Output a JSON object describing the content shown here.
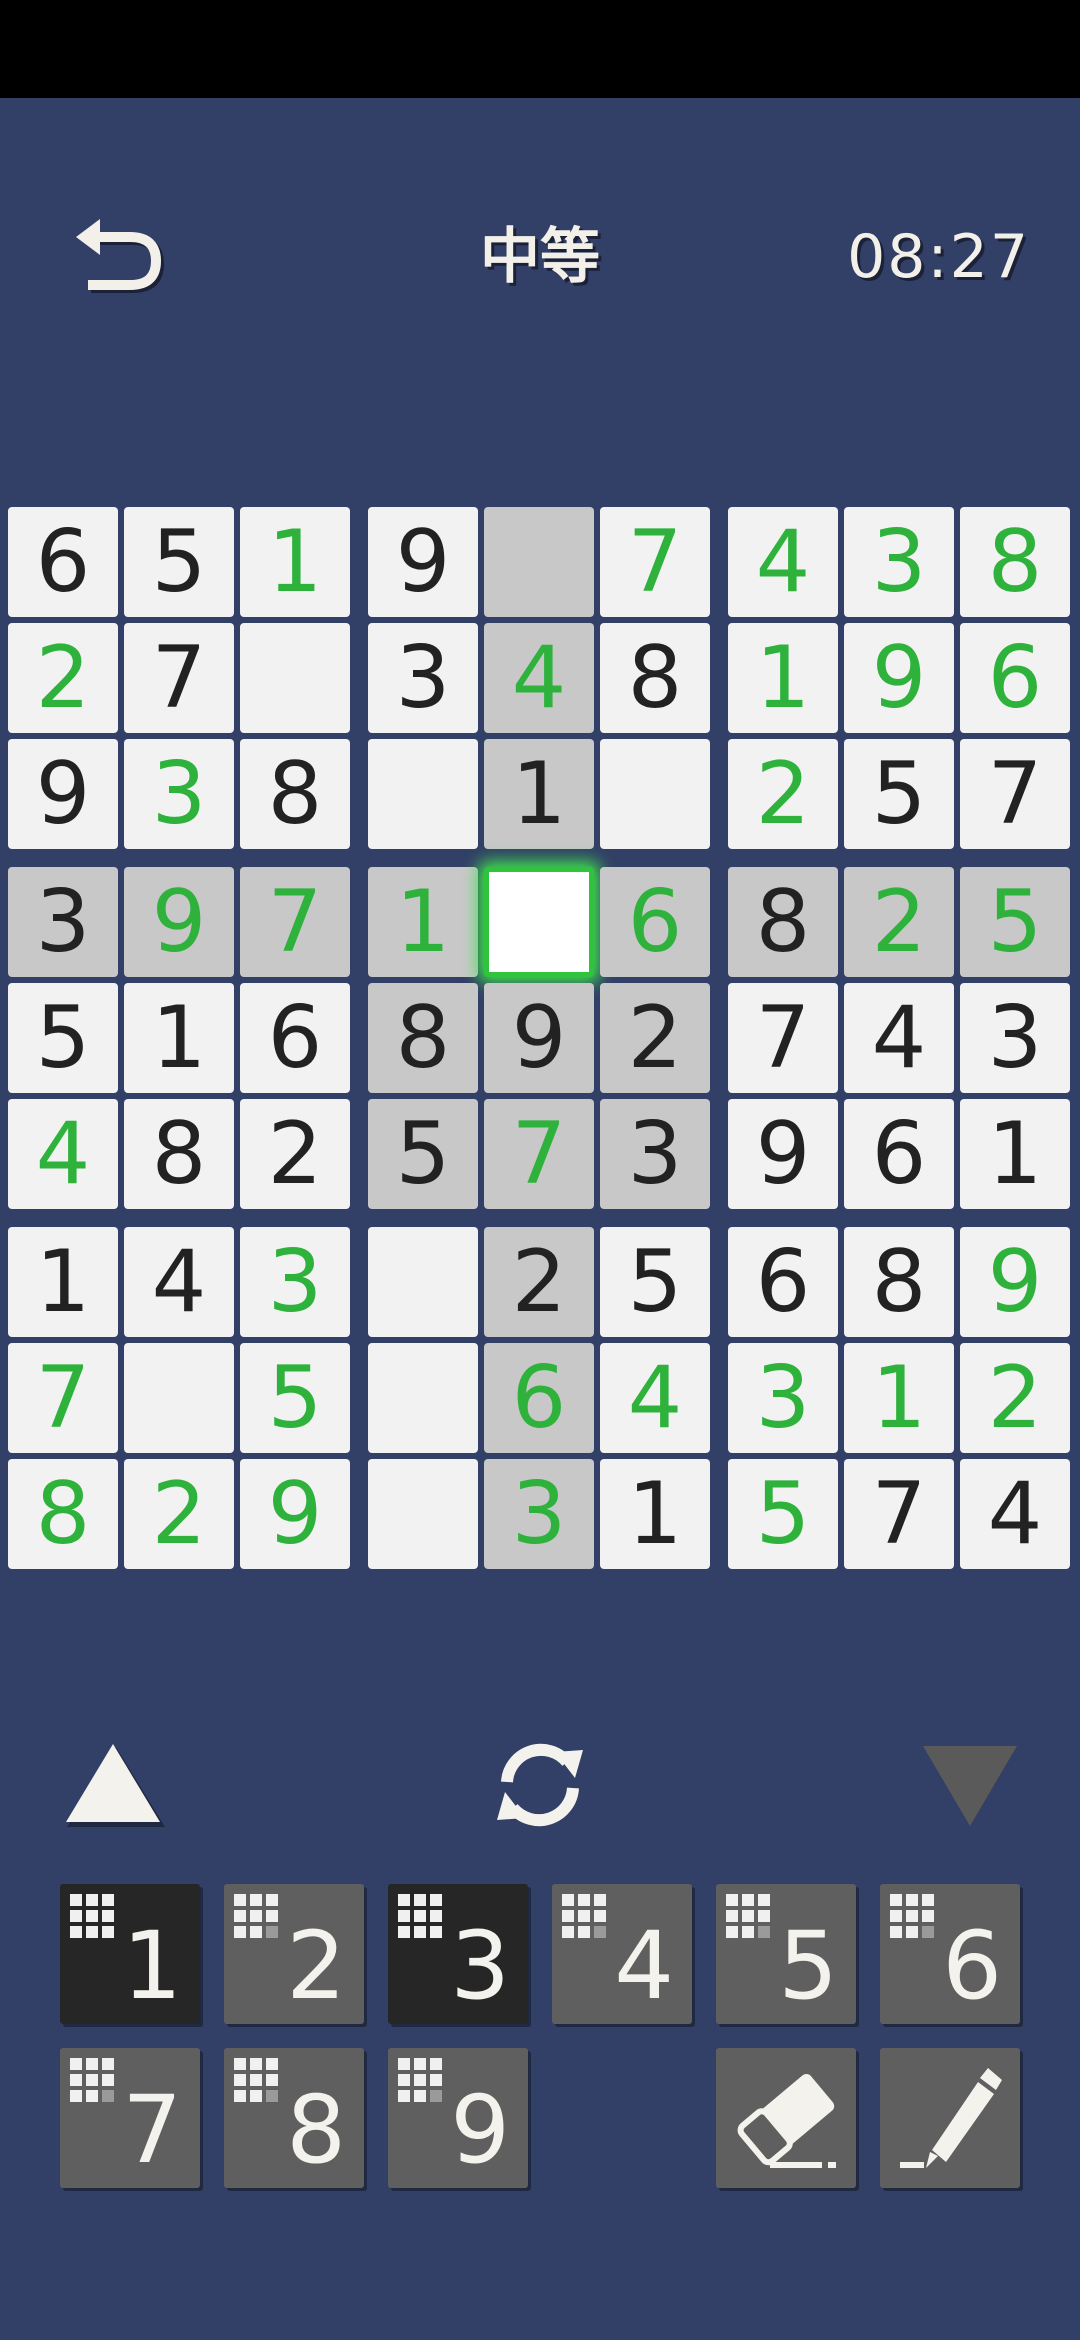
{
  "header": {
    "title": "中等",
    "timer": "08:27"
  },
  "colors": {
    "background": "#323f66",
    "given_digit": "#222222",
    "user_digit": "#2eb23c",
    "highlight": "#c8c8c8",
    "selected_glow": "#3ee04d"
  },
  "board": {
    "selected": [
      3,
      4
    ],
    "cells": [
      [
        {
          "v": "6",
          "t": "g"
        },
        {
          "v": "5",
          "t": "g"
        },
        {
          "v": "1",
          "t": "u"
        },
        {
          "v": "9",
          "t": "g"
        },
        {
          "v": "",
          "t": "e"
        },
        {
          "v": "7",
          "t": "u"
        },
        {
          "v": "4",
          "t": "u"
        },
        {
          "v": "3",
          "t": "u"
        },
        {
          "v": "8",
          "t": "u"
        }
      ],
      [
        {
          "v": "2",
          "t": "u"
        },
        {
          "v": "7",
          "t": "g"
        },
        {
          "v": "",
          "t": "e"
        },
        {
          "v": "3",
          "t": "g"
        },
        {
          "v": "4",
          "t": "u"
        },
        {
          "v": "8",
          "t": "g"
        },
        {
          "v": "1",
          "t": "u"
        },
        {
          "v": "9",
          "t": "u"
        },
        {
          "v": "6",
          "t": "u"
        }
      ],
      [
        {
          "v": "9",
          "t": "g"
        },
        {
          "v": "3",
          "t": "u"
        },
        {
          "v": "8",
          "t": "g"
        },
        {
          "v": "",
          "t": "e"
        },
        {
          "v": "1",
          "t": "g"
        },
        {
          "v": "",
          "t": "e"
        },
        {
          "v": "2",
          "t": "u"
        },
        {
          "v": "5",
          "t": "g"
        },
        {
          "v": "7",
          "t": "g"
        }
      ],
      [
        {
          "v": "3",
          "t": "g"
        },
        {
          "v": "9",
          "t": "u"
        },
        {
          "v": "7",
          "t": "u"
        },
        {
          "v": "1",
          "t": "u"
        },
        {
          "v": "",
          "t": "e"
        },
        {
          "v": "6",
          "t": "u"
        },
        {
          "v": "8",
          "t": "g"
        },
        {
          "v": "2",
          "t": "u"
        },
        {
          "v": "5",
          "t": "u"
        }
      ],
      [
        {
          "v": "5",
          "t": "g"
        },
        {
          "v": "1",
          "t": "g"
        },
        {
          "v": "6",
          "t": "g"
        },
        {
          "v": "8",
          "t": "g"
        },
        {
          "v": "9",
          "t": "g"
        },
        {
          "v": "2",
          "t": "g"
        },
        {
          "v": "7",
          "t": "g"
        },
        {
          "v": "4",
          "t": "g"
        },
        {
          "v": "3",
          "t": "g"
        }
      ],
      [
        {
          "v": "4",
          "t": "u"
        },
        {
          "v": "8",
          "t": "g"
        },
        {
          "v": "2",
          "t": "g"
        },
        {
          "v": "5",
          "t": "g"
        },
        {
          "v": "7",
          "t": "u"
        },
        {
          "v": "3",
          "t": "g"
        },
        {
          "v": "9",
          "t": "g"
        },
        {
          "v": "6",
          "t": "g"
        },
        {
          "v": "1",
          "t": "g"
        }
      ],
      [
        {
          "v": "1",
          "t": "g"
        },
        {
          "v": "4",
          "t": "g"
        },
        {
          "v": "3",
          "t": "u"
        },
        {
          "v": "",
          "t": "e"
        },
        {
          "v": "2",
          "t": "g"
        },
        {
          "v": "5",
          "t": "g"
        },
        {
          "v": "6",
          "t": "g"
        },
        {
          "v": "8",
          "t": "g"
        },
        {
          "v": "9",
          "t": "u"
        }
      ],
      [
        {
          "v": "7",
          "t": "u"
        },
        {
          "v": "",
          "t": "e"
        },
        {
          "v": "5",
          "t": "u"
        },
        {
          "v": "",
          "t": "e"
        },
        {
          "v": "6",
          "t": "u"
        },
        {
          "v": "4",
          "t": "u"
        },
        {
          "v": "3",
          "t": "u"
        },
        {
          "v": "1",
          "t": "u"
        },
        {
          "v": "2",
          "t": "u"
        }
      ],
      [
        {
          "v": "8",
          "t": "u"
        },
        {
          "v": "2",
          "t": "u"
        },
        {
          "v": "9",
          "t": "u"
        },
        {
          "v": "",
          "t": "e"
        },
        {
          "v": "3",
          "t": "u"
        },
        {
          "v": "1",
          "t": "g"
        },
        {
          "v": "5",
          "t": "u"
        },
        {
          "v": "7",
          "t": "g"
        },
        {
          "v": "4",
          "t": "g"
        }
      ]
    ]
  },
  "controls": {
    "prev_icon": "triangle-up-icon",
    "swap_icon": "refresh-icon",
    "next_icon": "triangle-down-icon"
  },
  "keypad": {
    "keys": [
      {
        "label": "1",
        "dark": true,
        "placed": 9
      },
      {
        "label": "2",
        "dark": false,
        "placed": 8
      },
      {
        "label": "3",
        "dark": true,
        "placed": 9
      },
      {
        "label": "4",
        "dark": false,
        "placed": 8
      },
      {
        "label": "5",
        "dark": false,
        "placed": 8
      },
      {
        "label": "6",
        "dark": false,
        "placed": 8
      },
      {
        "label": "7",
        "dark": false,
        "placed": 8
      },
      {
        "label": "8",
        "dark": false,
        "placed": 8
      },
      {
        "label": "9",
        "dark": false,
        "placed": 8
      }
    ],
    "eraser_icon": "eraser-icon",
    "pencil_icon": "pencil-icon"
  }
}
